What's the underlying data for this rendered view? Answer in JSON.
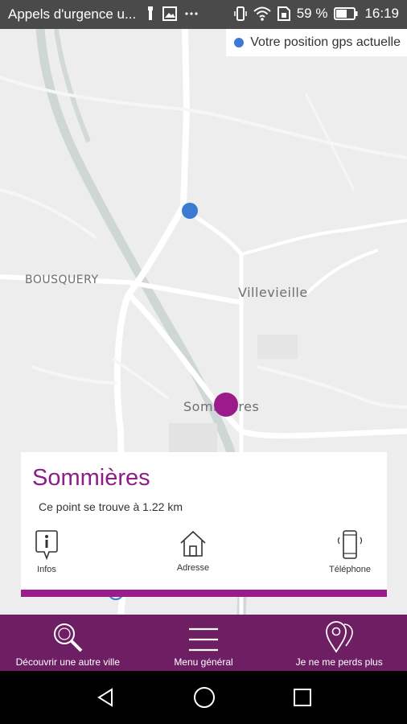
{
  "status_bar": {
    "app_title": "Appels d'urgence u...",
    "battery": "59 %",
    "time": "16:19"
  },
  "map": {
    "gps_legend": "Votre position gps actuelle",
    "place_labels": {
      "bousquery": "BOUSQUERY",
      "villevieille": "Villevieille",
      "sommieres": "Sommières"
    }
  },
  "info_card": {
    "city_name": "Sommières",
    "distance_text": "Ce point se trouve à 1.22 km",
    "actions": {
      "infos": "Infos",
      "adresse": "Adresse",
      "telephone": "Téléphone"
    }
  },
  "app_nav": {
    "discover": "Découvrir une autre ville",
    "menu": "Menu général",
    "lost": "Je ne me perds plus"
  },
  "colors": {
    "accent_purple": "#9c1b8c",
    "nav_purple": "#6e1f63",
    "gps_blue": "#3b7bd4"
  }
}
